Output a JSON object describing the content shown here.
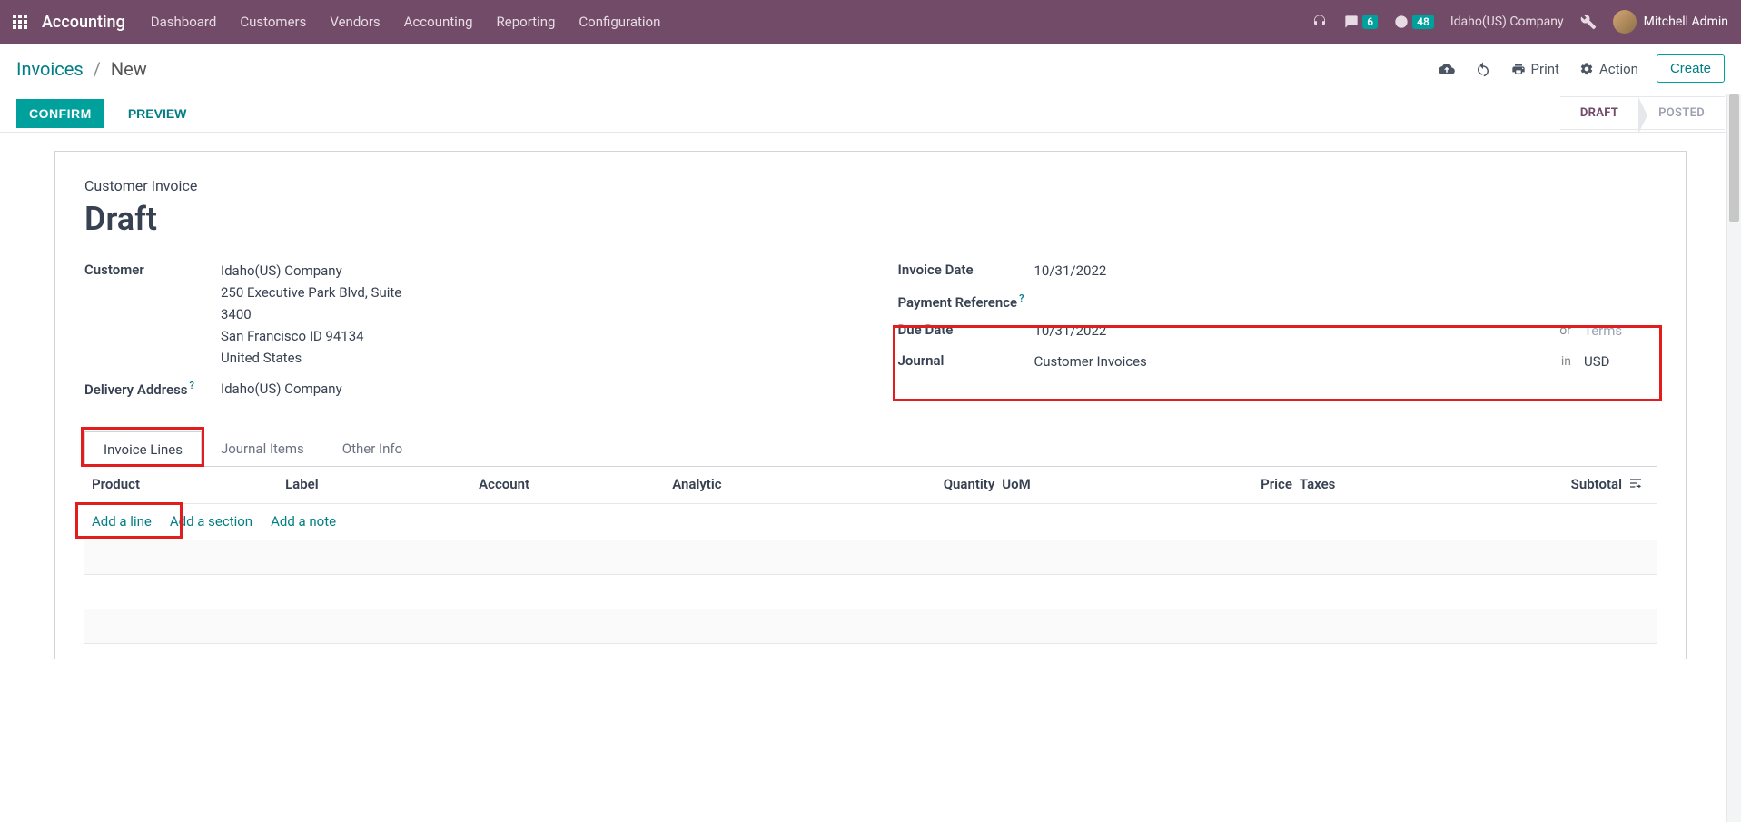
{
  "topnav": {
    "brand": "Accounting",
    "menu": [
      "Dashboard",
      "Customers",
      "Vendors",
      "Accounting",
      "Reporting",
      "Configuration"
    ],
    "notif_count": "6",
    "activity_count": "48",
    "company": "Idaho(US) Company",
    "user": "Mitchell Admin"
  },
  "breadcrumb": {
    "root": "Invoices",
    "current": "New"
  },
  "actions": {
    "print": "Print",
    "action": "Action",
    "create": "Create"
  },
  "buttons": {
    "confirm": "CONFIRM",
    "preview": "PREVIEW"
  },
  "status": {
    "draft": "DRAFT",
    "posted": "POSTED"
  },
  "form": {
    "subtitle": "Customer Invoice",
    "title": "Draft",
    "left": {
      "customer_label": "Customer",
      "customer_name": "Idaho(US) Company",
      "addr1": "250 Executive Park Blvd, Suite",
      "addr2": "3400",
      "addr3": "San Francisco ID 94134",
      "addr4": "United States",
      "delivery_label": "Delivery Address",
      "delivery_value": "Idaho(US) Company"
    },
    "right": {
      "invoice_date_label": "Invoice Date",
      "invoice_date": "10/31/2022",
      "payref_label": "Payment Reference",
      "due_label": "Due Date",
      "due_value": "10/31/2022",
      "due_or": "or",
      "due_terms_ph": "Terms",
      "journal_label": "Journal",
      "journal_value": "Customer Invoices",
      "journal_in": "in",
      "journal_cur": "USD"
    }
  },
  "tabs": {
    "t1": "Invoice Lines",
    "t2": "Journal Items",
    "t3": "Other Info"
  },
  "columns": {
    "product": "Product",
    "label": "Label",
    "account": "Account",
    "analytic": "Analytic",
    "qty": "Quantity",
    "uom": "UoM",
    "price": "Price",
    "taxes": "Taxes",
    "subtotal": "Subtotal"
  },
  "adders": {
    "line": "Add a line",
    "section": "Add a section",
    "note": "Add a note"
  }
}
